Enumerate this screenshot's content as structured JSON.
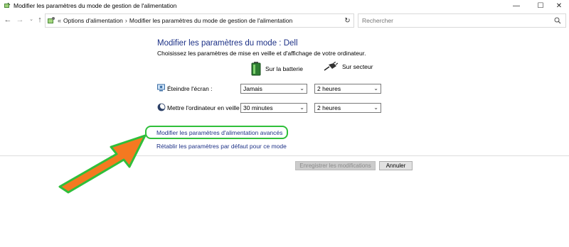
{
  "window": {
    "title": "Modifier les paramètres du mode de gestion de l'alimentation",
    "controls": {
      "minimize": "—",
      "maximize": "☐",
      "close": "✕"
    }
  },
  "navigation": {
    "back": "←",
    "forward": "→",
    "history": "⌄",
    "up": "↑",
    "breadcrumb_separator": "«",
    "breadcrumbs": [
      "Options d'alimentation",
      "Modifier les paramètres du mode de gestion de l'alimentation"
    ],
    "crumb_separator": "›",
    "refresh": "↻",
    "search_placeholder": "Rechercher"
  },
  "content": {
    "heading": "Modifier les paramètres du mode : Dell",
    "subheading": "Choisissez les paramètres de mise en veille et d'affichage de votre ordinateur.",
    "columns": {
      "battery": "Sur la batterie",
      "plugged": "Sur secteur"
    },
    "rows": [
      {
        "label": "Éteindre l'écran :",
        "battery_value": "Jamais",
        "plugged_value": "2 heures"
      },
      {
        "label": "Mettre l'ordinateur en veille :",
        "battery_value": "30 minutes",
        "plugged_value": "2 heures"
      }
    ],
    "links": {
      "advanced": "Modifier les paramètres d'alimentation avancés",
      "restore": "Rétablir les paramètres par défaut pour ce mode"
    },
    "buttons": {
      "save": "Enregistrer les modifications",
      "cancel": "Annuler"
    }
  },
  "annotation": {
    "highlight_color": "#2fbf3a",
    "arrow_fill": "#f47920",
    "arrow_stroke": "#2fbf3a"
  },
  "colors": {
    "heading": "#1e3287",
    "link": "#1e3287"
  }
}
